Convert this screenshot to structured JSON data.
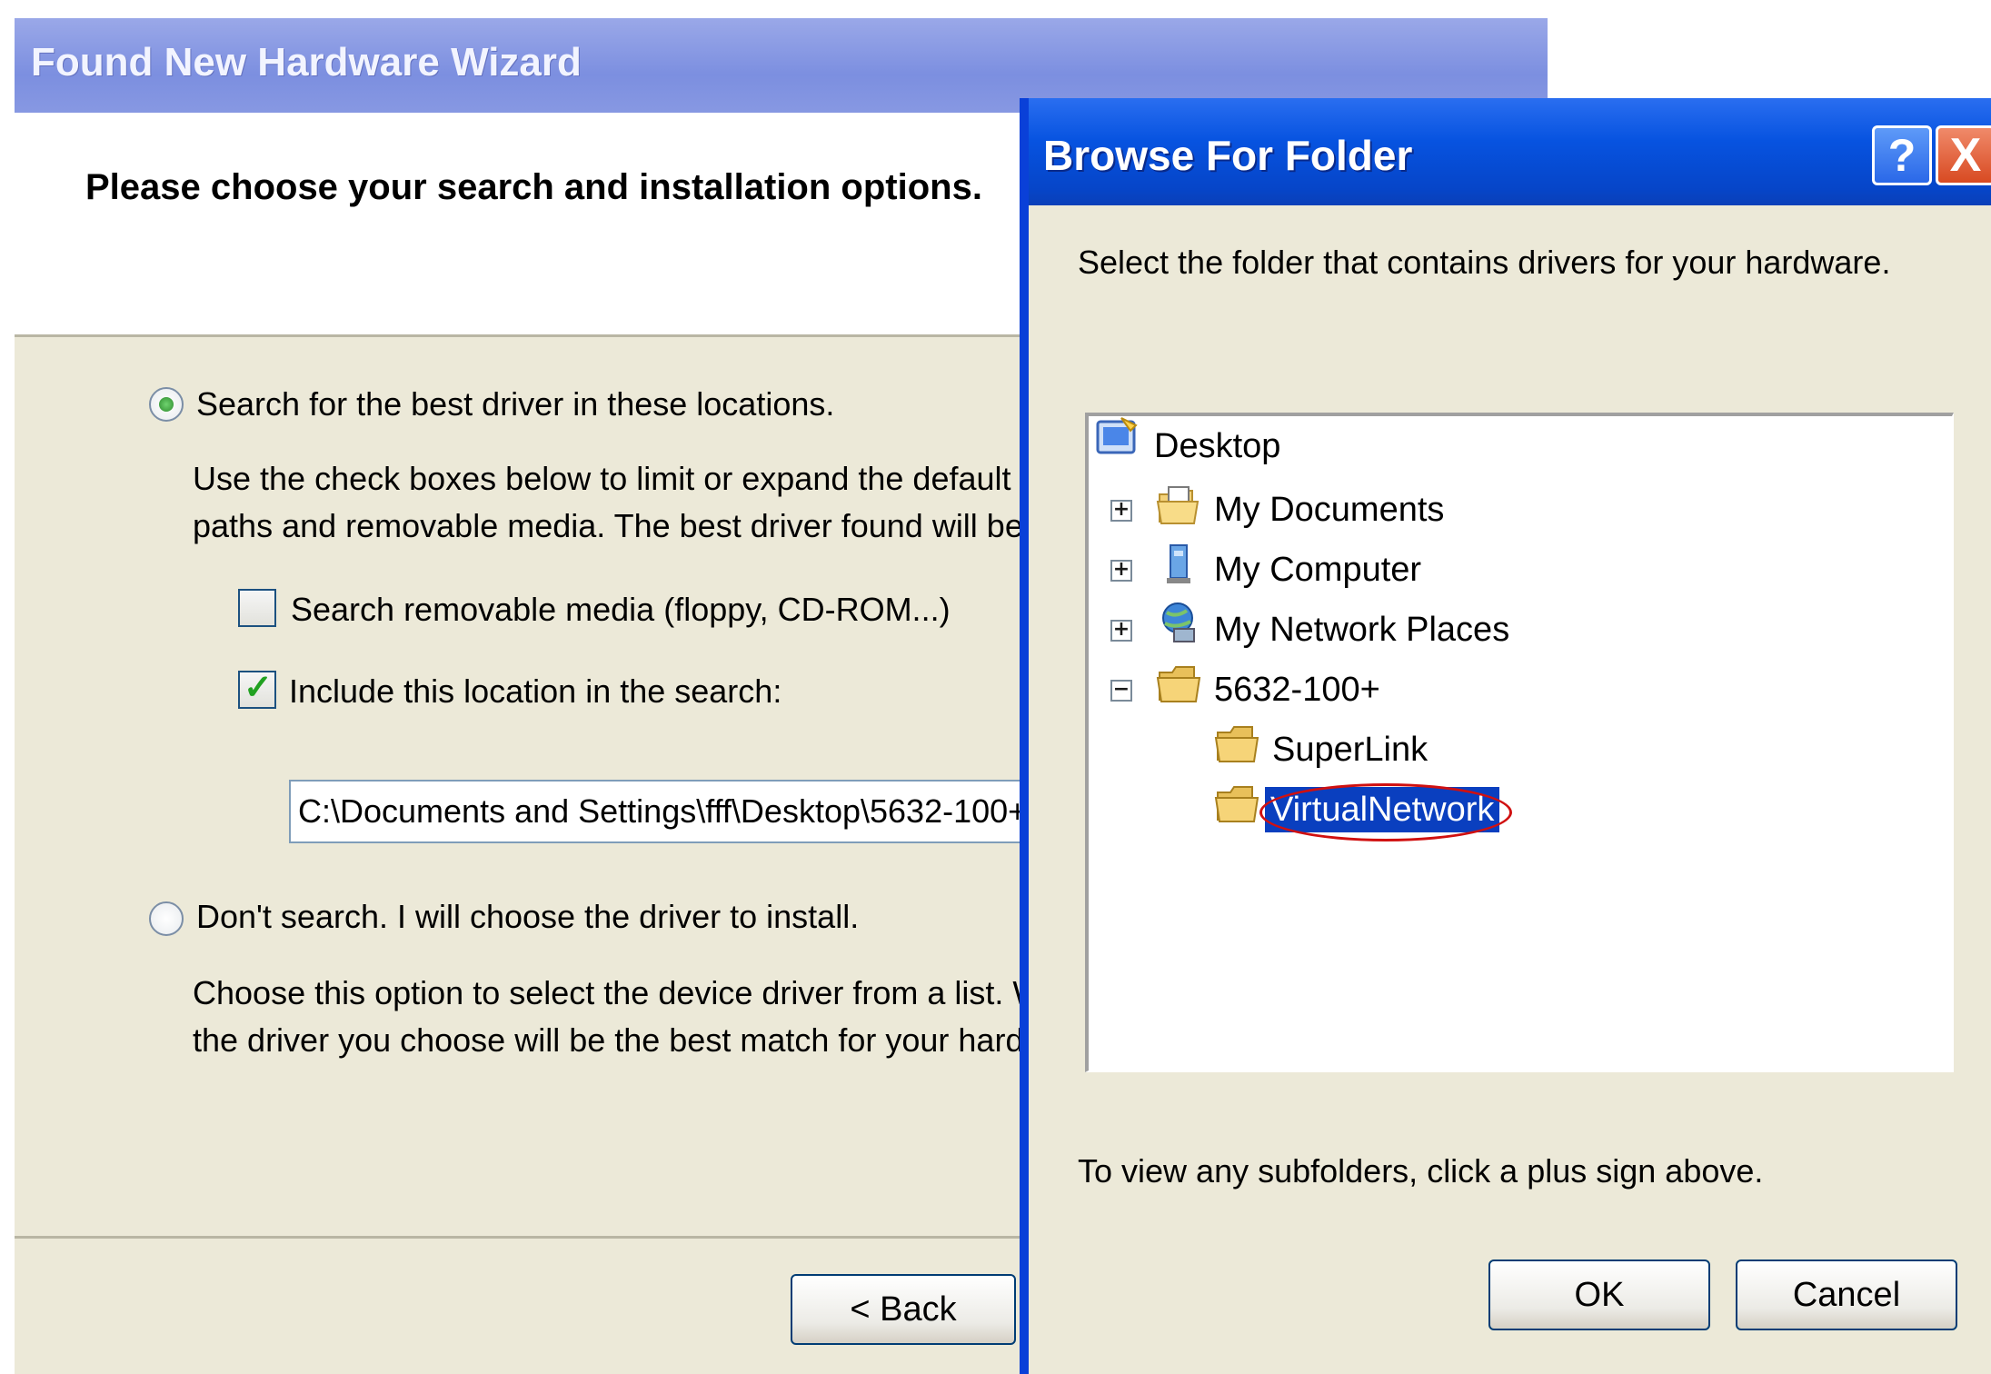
{
  "wizard": {
    "title": "Found New Hardware Wizard",
    "heading": "Please choose your search and installation options.",
    "option_search": {
      "label": "Search for the best driver in these locations.",
      "selected": true,
      "description_line1": "Use the check boxes below to limit or expand the default",
      "description_line2": "paths and removable media. The best driver found will be"
    },
    "checkbox_removable": {
      "label": "Search removable media (floppy, CD-ROM...)",
      "checked": false
    },
    "checkbox_include": {
      "label": "Include this location in the search:",
      "checked": true
    },
    "path_value": "C:\\Documents and Settings\\fff\\Desktop\\5632-100+",
    "option_dont_search": {
      "label": "Don't search. I will choose the driver to install.",
      "selected": false,
      "description_line1": "Choose this option to select the device driver from a list. W",
      "description_line2": "the driver you choose will be the best match for your hardware."
    },
    "back_button": "< Back"
  },
  "browse_dialog": {
    "title": "Browse For Folder",
    "help_glyph": "?",
    "close_glyph": "X",
    "instruction": "Select the folder that contains drivers for your hardware.",
    "tree": [
      {
        "label": "Desktop",
        "icon": "desktop-icon",
        "expander": ""
      },
      {
        "label": "My Documents",
        "icon": "my-documents-folder-icon",
        "expander": "+"
      },
      {
        "label": "My Computer",
        "icon": "my-computer-icon",
        "expander": "+"
      },
      {
        "label": "My Network Places",
        "icon": "network-places-icon",
        "expander": "+"
      },
      {
        "label": "5632-100+",
        "icon": "folder-icon",
        "expander": "−"
      },
      {
        "label": "SuperLink",
        "icon": "folder-icon",
        "expander": ""
      },
      {
        "label": "VirtualNetwork",
        "icon": "folder-icon",
        "expander": "",
        "selected": true
      }
    ],
    "hint": "To view any subfolders, click a plus sign above.",
    "ok_button": "OK",
    "cancel_button": "Cancel"
  }
}
